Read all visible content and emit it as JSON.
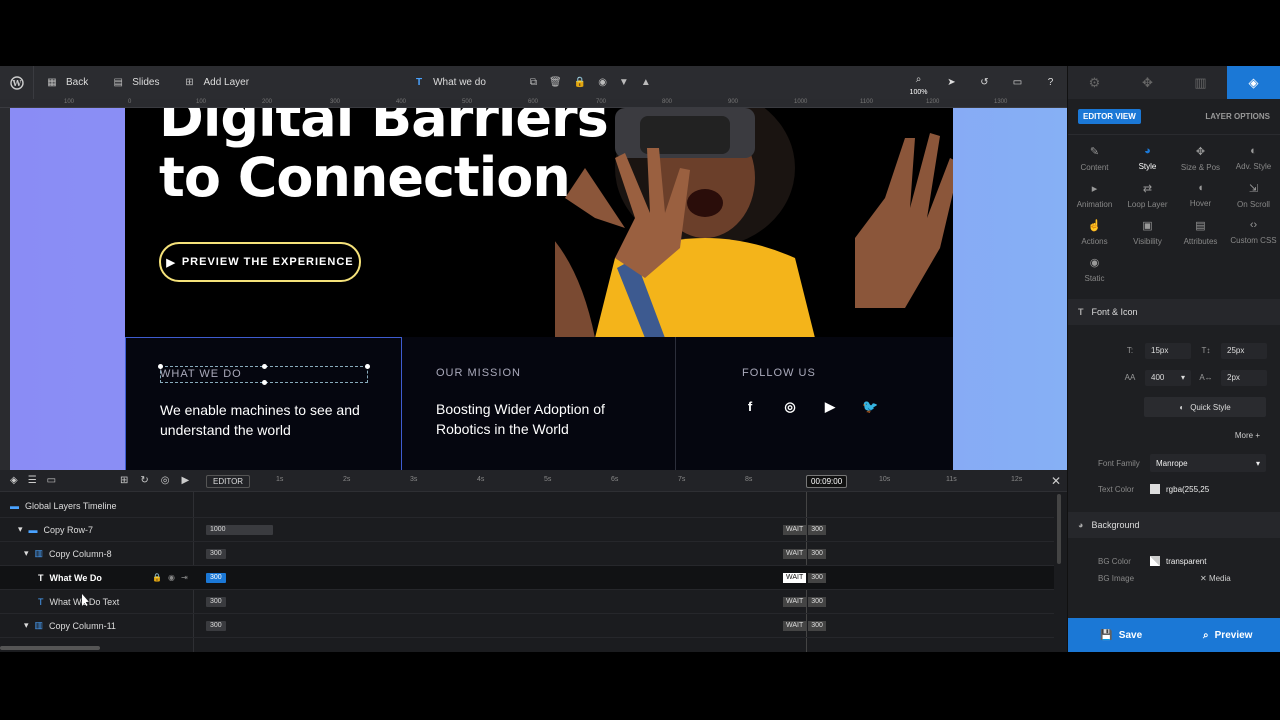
{
  "toolbar": {
    "back": "Back",
    "slides": "Slides",
    "add_layer": "Add Layer",
    "layer_name": "What we do",
    "zoom": "100%"
  },
  "ruler": [
    "100",
    "0",
    "100",
    "200",
    "300",
    "400",
    "500",
    "600",
    "700",
    "800",
    "900",
    "1000",
    "1100",
    "1200",
    "1300"
  ],
  "vruler": [
    "100",
    "200",
    "300",
    "400",
    "500",
    "600",
    "700",
    "800"
  ],
  "slide": {
    "title": "Digital Barriers\nto Connection",
    "cta": "PREVIEW THE EXPERIENCE",
    "features": [
      {
        "label": "WHAT WE DO",
        "text": "We enable machines to see and understand the world"
      },
      {
        "label": "OUR MISSION",
        "text": "Boosting Wider Adoption of Robotics in the World"
      },
      {
        "label": "FOLLOW US",
        "text": ""
      }
    ],
    "socials": [
      "f",
      "◎",
      "▶",
      "🐦"
    ]
  },
  "timeline": {
    "editor": "EDITOR",
    "current_time": "00:09:00",
    "ticks": [
      "1s",
      "2s",
      "3s",
      "4s",
      "5s",
      "6s",
      "7s",
      "8s",
      "9s",
      "10s",
      "11s",
      "12s"
    ],
    "rows": [
      {
        "name": "Global Layers Timeline",
        "bar": "",
        "wait": ""
      },
      {
        "name": "Copy Row-7",
        "bar": "1000",
        "wait": "WAIT",
        "waitval": "300"
      },
      {
        "name": "Copy Column-8",
        "bar": "300",
        "wait": "WAIT",
        "waitval": "300"
      },
      {
        "name": "What We Do",
        "bar": "300",
        "wait": "WAIT",
        "waitval": "300"
      },
      {
        "name": "What We Do Text",
        "bar": "300",
        "wait": "WAIT",
        "waitval": "300"
      },
      {
        "name": "Copy Column-11",
        "bar": "300",
        "wait": "WAIT",
        "waitval": "300"
      }
    ]
  },
  "panel": {
    "editor_view": "EDITOR VIEW",
    "layer_options": "LAYER OPTIONS",
    "options": [
      {
        "label": "Content",
        "icon": "✎"
      },
      {
        "label": "Style",
        "icon": "◕"
      },
      {
        "label": "Size & Pos",
        "icon": "✥"
      },
      {
        "label": "Adv. Style",
        "icon": "◐"
      },
      {
        "label": "Animation",
        "icon": "▸"
      },
      {
        "label": "Loop Layer",
        "icon": "⇄"
      },
      {
        "label": "Hover",
        "icon": "◖"
      },
      {
        "label": "On Scroll",
        "icon": "⇲"
      },
      {
        "label": "Actions",
        "icon": "☝"
      },
      {
        "label": "Visibility",
        "icon": "▣"
      },
      {
        "label": "Attributes",
        "icon": "▤"
      },
      {
        "label": "Custom CSS",
        "icon": "‹›"
      },
      {
        "label": "Static",
        "icon": "◉"
      }
    ],
    "font_icon": "Font & Icon",
    "font_size": "15px",
    "line_height": "25px",
    "font_weight": "400",
    "letter_spacing": "2px",
    "quick_style": "Quick Style",
    "more": "More",
    "font_family_label": "Font Family",
    "font_family": "Manrope",
    "text_color_label": "Text Color",
    "text_color": "rgba(255,25",
    "background": "Background",
    "bg_color_label": "BG Color",
    "bg_color": "transparent",
    "bg_image_label": "BG Image",
    "media": "Media",
    "save": "Save",
    "preview": "Preview"
  }
}
